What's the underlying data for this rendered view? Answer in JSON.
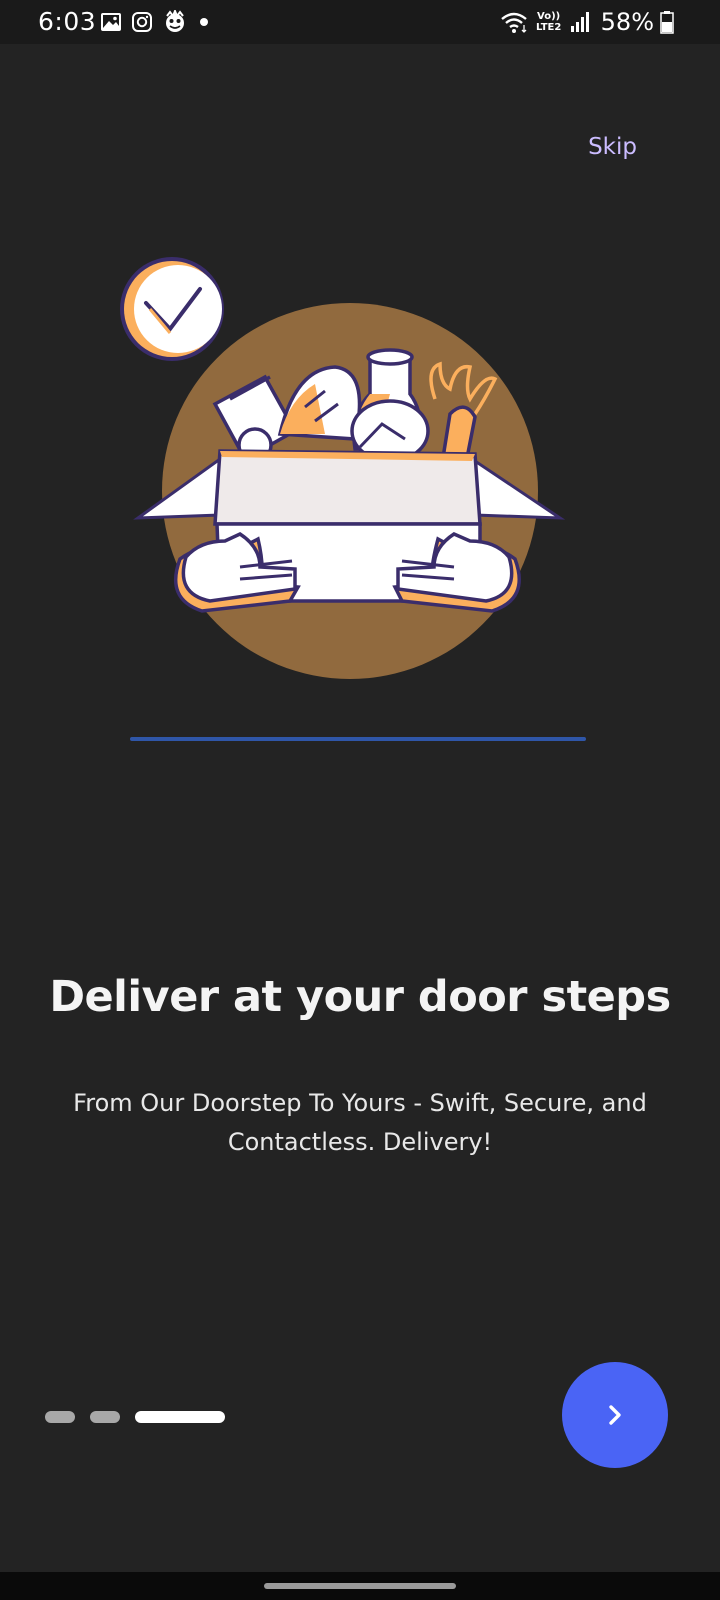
{
  "status_bar": {
    "time": "6:03",
    "battery": "58%",
    "network_label": "Vo)) LTE2",
    "icons": [
      "gallery-icon",
      "instagram-icon",
      "mascot-icon",
      "notification-dot-icon",
      "wifi-icon",
      "lte-icon",
      "signal-icon",
      "battery-icon"
    ]
  },
  "onboarding": {
    "skip_label": "Skip",
    "title": "Deliver at your door steps",
    "subtitle": "From Our Doorstep To Yours - Swift, Secure, and Contactless. Delivery!",
    "page_count": 3,
    "active_page": 3,
    "next_icon": "chevron-right-icon"
  },
  "colors": {
    "background": "#232323",
    "accent": "#4a64f5",
    "skip": "#cbbcff",
    "illustration_circle": "#916a3e",
    "divider": "#2f56a8"
  }
}
